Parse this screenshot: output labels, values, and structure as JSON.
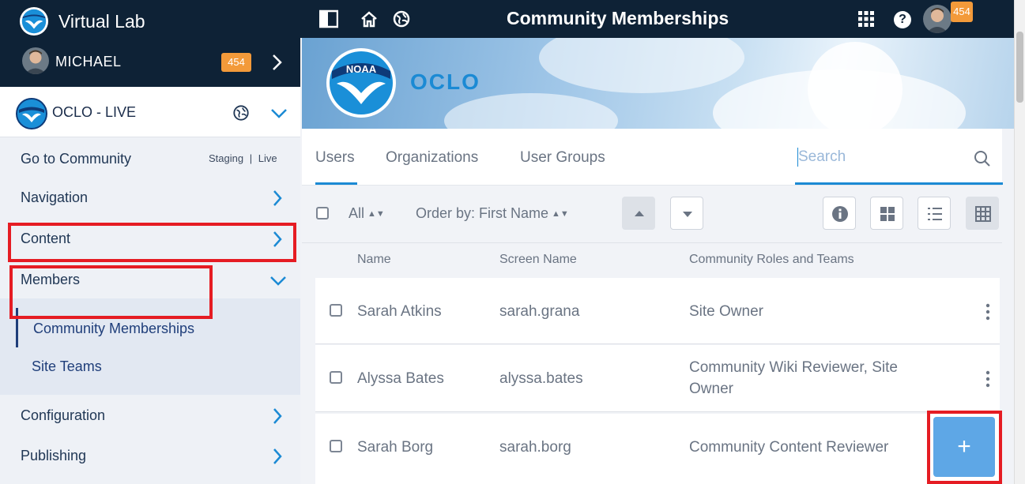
{
  "app": {
    "name": "Virtual Lab",
    "page_title": "Community Memberships",
    "notification_count": "454"
  },
  "user": {
    "name": "MICHAEL",
    "badge": "454"
  },
  "site": {
    "name": "OCLO - LIVE"
  },
  "goto": {
    "label": "Go to Community",
    "staging": "Staging",
    "separator": "|",
    "live": "Live"
  },
  "nav": {
    "navigation": "Navigation",
    "content": "Content",
    "members": "Members",
    "community_memberships": "Community Memberships",
    "site_teams": "Site Teams",
    "configuration": "Configuration",
    "publishing": "Publishing"
  },
  "banner": {
    "logo_text": "NOAA",
    "title": "OCLO"
  },
  "tabs": {
    "users": "Users",
    "organizations": "Organizations",
    "user_groups": "User Groups",
    "search_placeholder": "Search"
  },
  "toolbar": {
    "filter": "All",
    "order_by": "Order by: First Name"
  },
  "table": {
    "headers": [
      "Name",
      "Screen Name",
      "Community Roles and Teams"
    ],
    "rows": [
      {
        "name": "Sarah Atkins",
        "screen_name": "sarah.grana",
        "roles_line1": "Site Owner",
        "roles_line2": ""
      },
      {
        "name": "Alyssa Bates",
        "screen_name": "alyssa.bates",
        "roles_line1": "Community Wiki Reviewer, Site",
        "roles_line2": "Owner"
      },
      {
        "name": "Sarah Borg",
        "screen_name": "sarah.borg",
        "roles_line1": "Community Content Reviewer",
        "roles_line2": ""
      }
    ]
  },
  "fab": {
    "label": "+"
  },
  "colors": {
    "topbar": "#0e2236",
    "accent": "#1b8ad4",
    "badge": "#f39a3a",
    "highlight": "#e51c23",
    "fab": "#5ea7e6"
  }
}
